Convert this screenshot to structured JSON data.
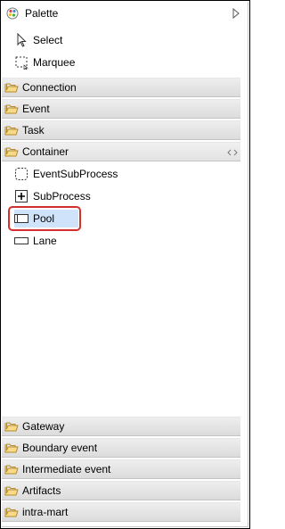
{
  "palette": {
    "title": "Palette",
    "tools": [
      {
        "label": "Select",
        "icon": "arrow-cursor-icon"
      },
      {
        "label": "Marquee",
        "icon": "marquee-icon"
      }
    ],
    "drawers_top": [
      {
        "label": "Connection"
      },
      {
        "label": "Event"
      },
      {
        "label": "Task"
      },
      {
        "label": "Container"
      }
    ],
    "container_items": [
      {
        "label": "EventSubProcess",
        "icon": "dashed-rounded-rect-icon"
      },
      {
        "label": "SubProcess",
        "icon": "plus-box-icon"
      },
      {
        "label": "Pool",
        "icon": "pool-icon",
        "selected": true
      },
      {
        "label": "Lane",
        "icon": "lane-icon"
      }
    ],
    "drawers_bottom": [
      {
        "label": "Gateway"
      },
      {
        "label": "Boundary event"
      },
      {
        "label": "Intermediate event"
      },
      {
        "label": "Artifacts"
      },
      {
        "label": "intra-mart"
      }
    ],
    "colors": {
      "selection": "#cfe4fa",
      "highlight_border": "#d0312d",
      "folder": "#f2c260"
    }
  }
}
